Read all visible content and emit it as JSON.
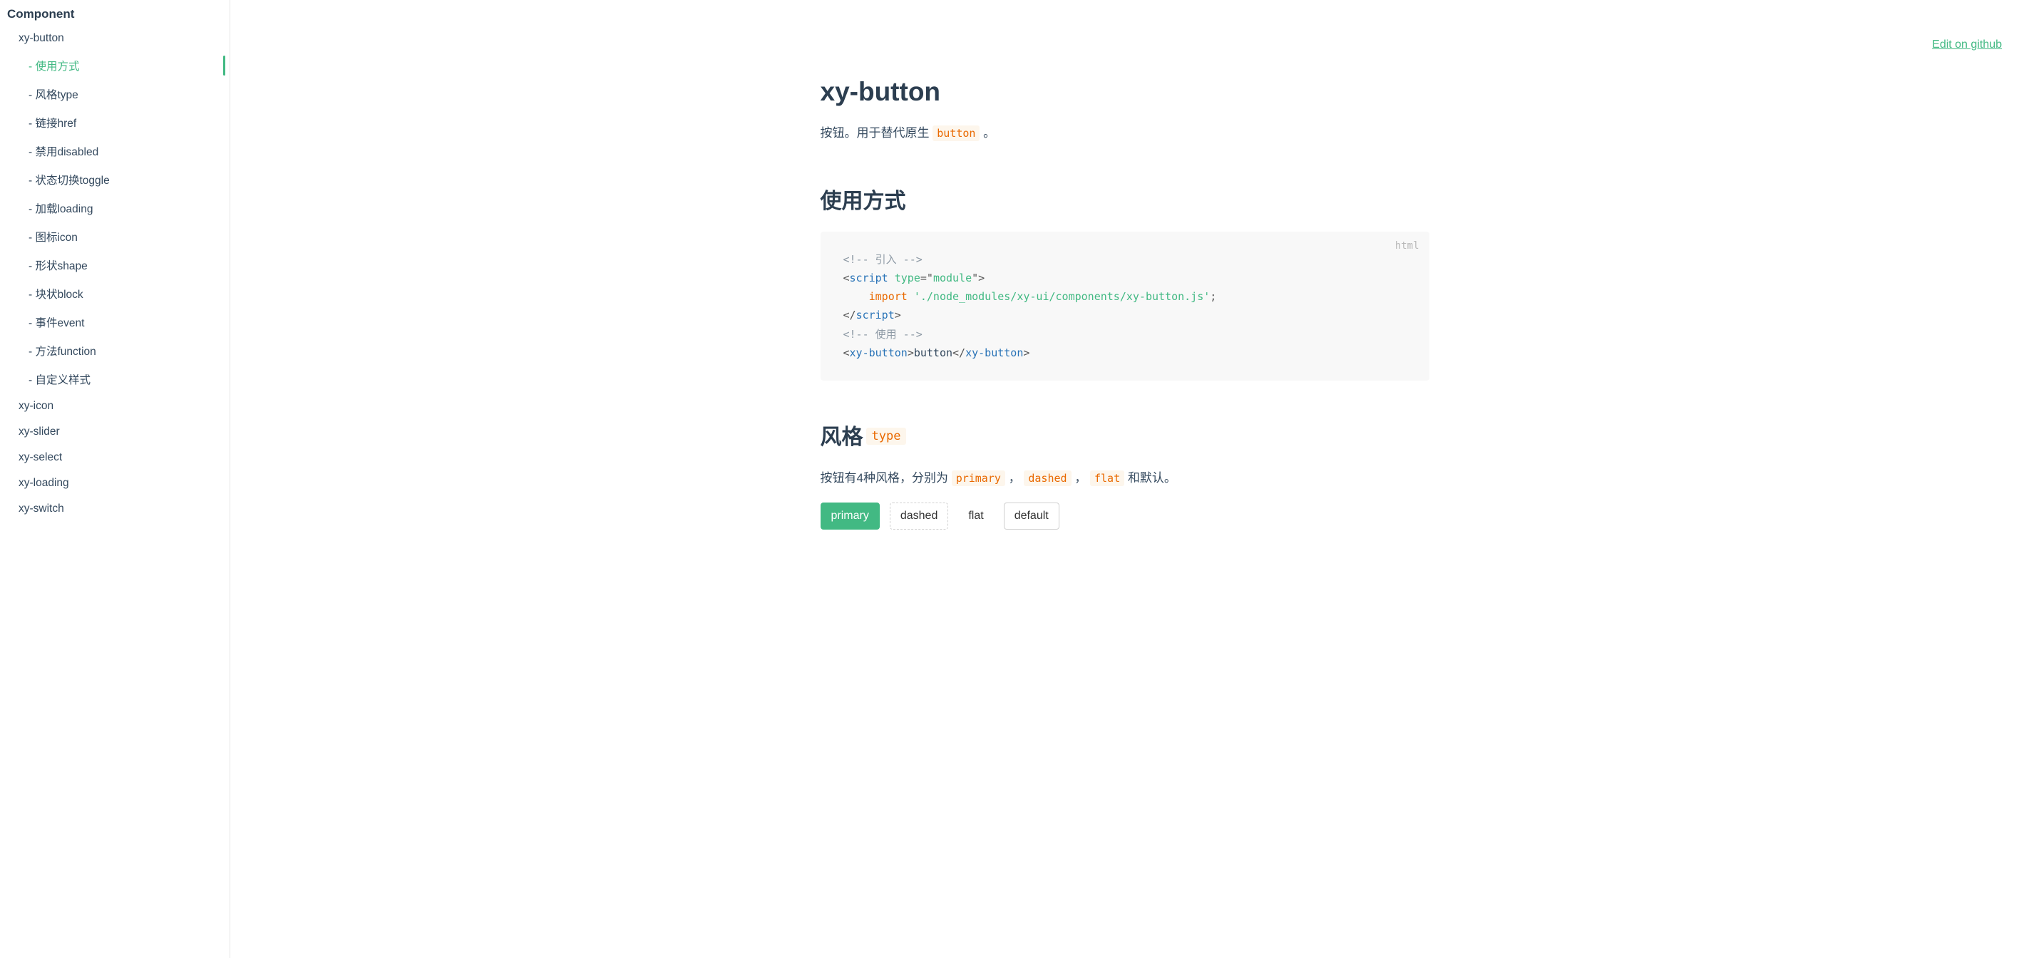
{
  "sidebar": {
    "heading": "Component",
    "top": [
      {
        "label": "xy-button",
        "expanded": true
      }
    ],
    "sub": [
      {
        "label": "- 使用方式",
        "active": true
      },
      {
        "label": "- 风格type"
      },
      {
        "label": "- 链接href"
      },
      {
        "label": "- 禁用disabled"
      },
      {
        "label": "- 状态切换toggle"
      },
      {
        "label": "- 加载loading"
      },
      {
        "label": "- 图标icon"
      },
      {
        "label": "- 形状shape"
      },
      {
        "label": "- 块状block"
      },
      {
        "label": "- 事件event"
      },
      {
        "label": "- 方法function"
      },
      {
        "label": "- 自定义样式"
      }
    ],
    "rest": [
      {
        "label": "xy-icon"
      },
      {
        "label": "xy-slider"
      },
      {
        "label": "xy-select"
      },
      {
        "label": "xy-loading"
      },
      {
        "label": "xy-switch"
      }
    ]
  },
  "header_link": "Edit on github",
  "title": "xy-button",
  "desc_parts": {
    "before": "按钮。用于替代原生 ",
    "code": "button",
    "after": " 。"
  },
  "section_usage": {
    "heading": "使用方式",
    "lang": "html",
    "code": {
      "l1_comment": "<!-- 引入 -->",
      "l2_open": "<",
      "l2_tag": "script",
      "l2_sp": " ",
      "l2_attr": "type",
      "l2_eq": "=",
      "l2_q1": "\"",
      "l2_val": "module",
      "l2_q2": "\"",
      "l2_close": ">",
      "l3_indent": "    ",
      "l3_kw": "import",
      "l3_sp": " ",
      "l3_str": "'./node_modules/xy-ui/components/xy-button.js'",
      "l3_semi": ";",
      "l4_open": "</",
      "l4_tag": "script",
      "l4_close": ">",
      "l5_comment": "<!-- 使用 -->",
      "l6_open": "<",
      "l6_tag": "xy-button",
      "l6_gt": ">",
      "l6_txt": "button",
      "l6_open2": "</",
      "l6_tag2": "xy-button",
      "l6_close": ">"
    }
  },
  "section_style": {
    "heading": "风格",
    "heading_code": "type",
    "desc": {
      "t1": "按钮有4种风格，分别为 ",
      "c1": "primary",
      "t2": " ， ",
      "c2": "dashed",
      "t3": " ， ",
      "c3": "flat",
      "t4": " 和默认。"
    },
    "buttons": {
      "primary": "primary",
      "dashed": "dashed",
      "flat": "flat",
      "default": "default"
    }
  }
}
